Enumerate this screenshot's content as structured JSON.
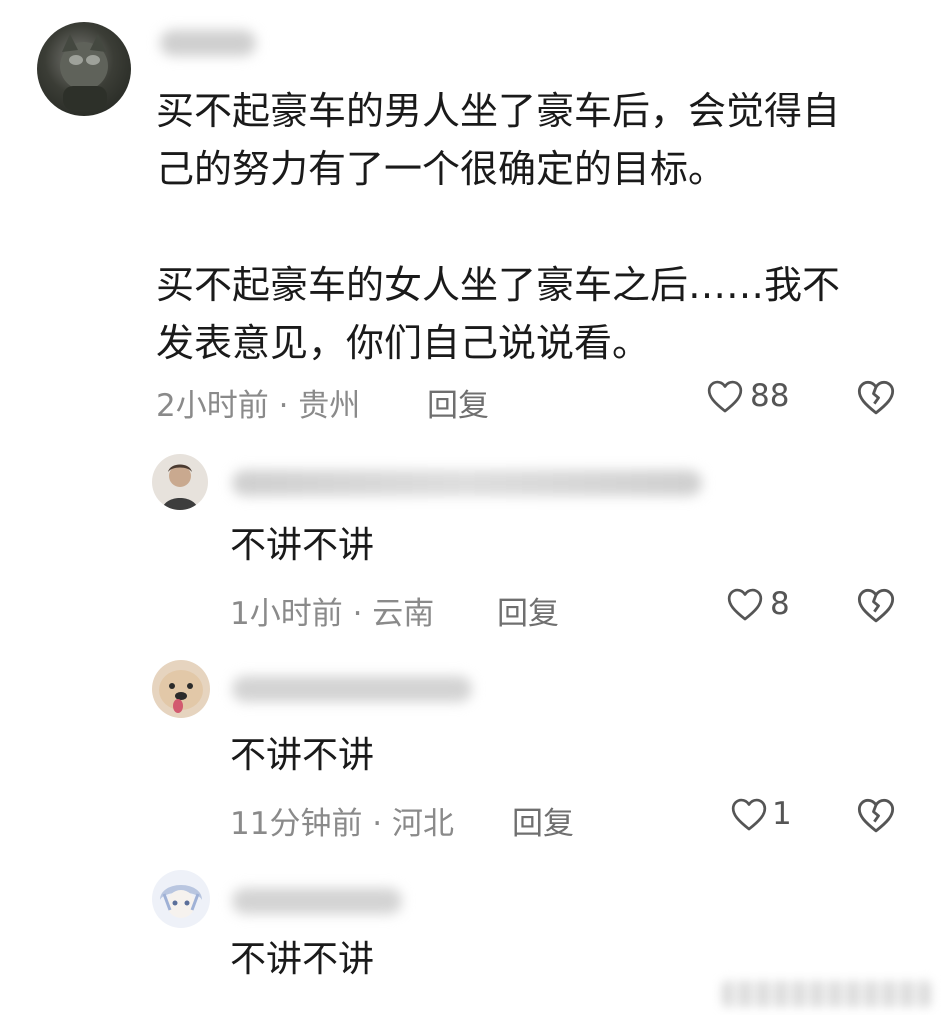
{
  "main_comment": {
    "text_line1": "买不起豪车的男人坐了豪车后，会觉得自",
    "text_line2": "己的努力有了一个很确定的目标。",
    "text_line3": "买不起豪车的女人坐了豪车之后……我不",
    "text_line4": "发表意见，你们自己说说看。",
    "meta": "2小时前 · 贵州",
    "reply_label": "回复",
    "likes": "88"
  },
  "replies": [
    {
      "text": "不讲不讲",
      "meta": "1小时前 · 云南",
      "reply_label": "回复",
      "likes": "8"
    },
    {
      "text": "不讲不讲",
      "meta": "11分钟前 · 河北",
      "reply_label": "回复",
      "likes": "1"
    },
    {
      "text": "不讲不讲"
    }
  ],
  "icons": {
    "like": "heart-outline-icon",
    "dislike": "broken-heart-icon"
  },
  "colors": {
    "text": "#1a1a1a",
    "meta": "#8a8a8a",
    "icon": "#555555"
  }
}
